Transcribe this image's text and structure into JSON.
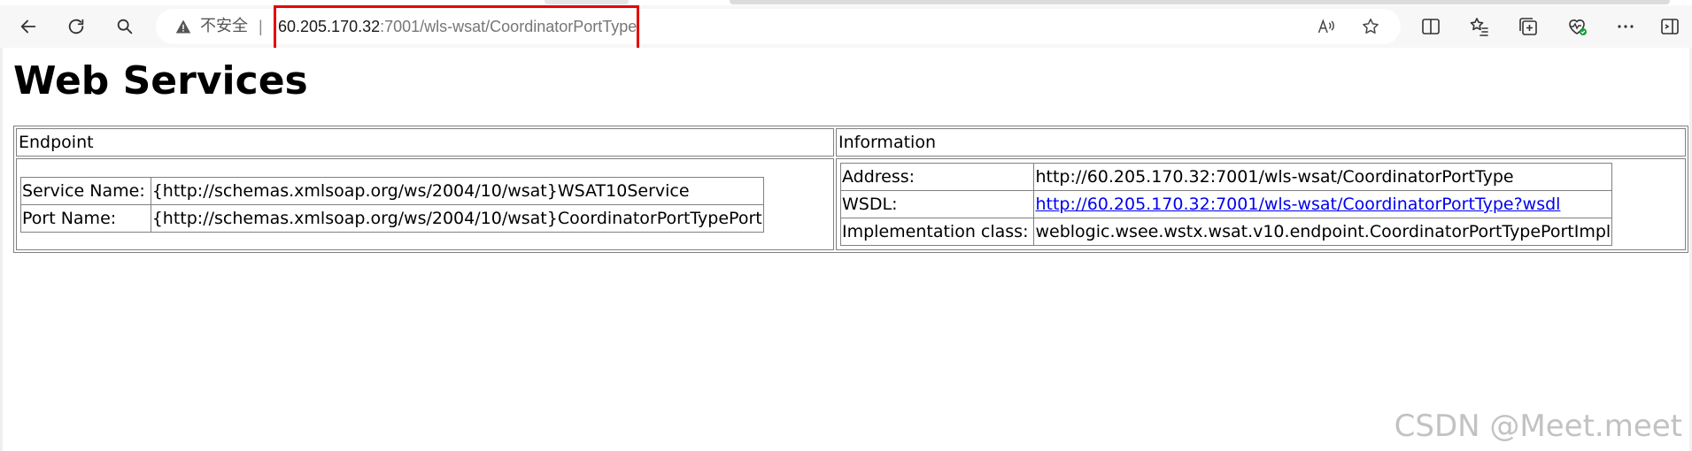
{
  "browser": {
    "security_label": "不安全",
    "separator": "|",
    "url_host": "60.205.170.32",
    "url_path": ":7001/wls-wsat/CoordinatorPortType",
    "icons": {
      "back": "back-arrow-icon",
      "refresh": "refresh-icon",
      "search": "search-icon",
      "warning": "warning-icon",
      "read_aloud": "read-aloud-icon",
      "favorite": "star-icon",
      "split_screen": "split-screen-icon",
      "favorites": "favorites-list-icon",
      "collections": "collections-icon",
      "health": "browser-essentials-icon",
      "more": "more-icon",
      "sidebar": "sidebar-icon"
    },
    "highlight_color": "#e60000"
  },
  "page": {
    "title": "Web Services",
    "table": {
      "headers": [
        "Endpoint",
        "Information"
      ],
      "endpoint": {
        "service_label": "Service Name:",
        "service_value": "{http://schemas.xmlsoap.org/ws/2004/10/wsat}WSAT10Service",
        "port_label": "Port Name:",
        "port_value": "{http://schemas.xmlsoap.org/ws/2004/10/wsat}CoordinatorPortTypePort"
      },
      "information": {
        "address_label": "Address:",
        "address_value": "http://60.205.170.32:7001/wls-wsat/CoordinatorPortType",
        "wsdl_label": "WSDL:",
        "wsdl_value": "http://60.205.170.32:7001/wls-wsat/CoordinatorPortType?wsdl",
        "impl_label": "Implementation class:",
        "impl_value": "weblogic.wsee.wstx.wsat.v10.endpoint.CoordinatorPortTypePortImpl"
      }
    }
  },
  "watermark": "CSDN @Meet.meet",
  "colors": {
    "link": "#0000ee",
    "toolbar_bg": "#f7f7f7"
  }
}
